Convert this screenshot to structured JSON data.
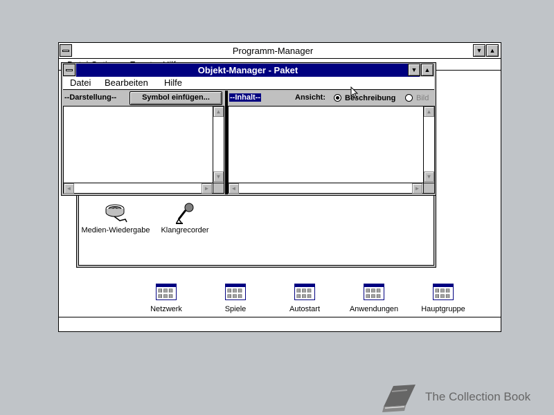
{
  "program_manager": {
    "title": "Programm-Manager",
    "menu_partial": "Datei  Optionen  Fenster  Hilfe",
    "group_icons": [
      {
        "label": "Netzwerk"
      },
      {
        "label": "Spiele"
      },
      {
        "label": "Autostart"
      },
      {
        "label": "Anwendungen"
      },
      {
        "label": "Hauptgruppe"
      }
    ]
  },
  "group_window": {
    "icons": [
      {
        "label": "Medien-Wiedergabe",
        "icon": "film-reel-icon"
      },
      {
        "label": "Klangrecorder",
        "icon": "microphone-icon"
      }
    ]
  },
  "object_manager": {
    "title": "Objekt-Manager - Paket",
    "menu": [
      "Datei",
      "Bearbeiten",
      "Hilfe"
    ],
    "left_panel_label": "--Darstellung--",
    "insert_button": "Symbol einfügen...",
    "right_panel_label": "--Inhalt--",
    "view_label": "Ansicht:",
    "view_options": [
      {
        "label": "Beschreibung",
        "selected": true
      },
      {
        "label": "Bild",
        "selected": false
      }
    ]
  },
  "watermark": {
    "text": "The Collection Book",
    "icon": "book-icon"
  },
  "colors": {
    "desktop": "#c0c4c8",
    "title_active": "#000080",
    "window_face": "#c0c0c0"
  }
}
